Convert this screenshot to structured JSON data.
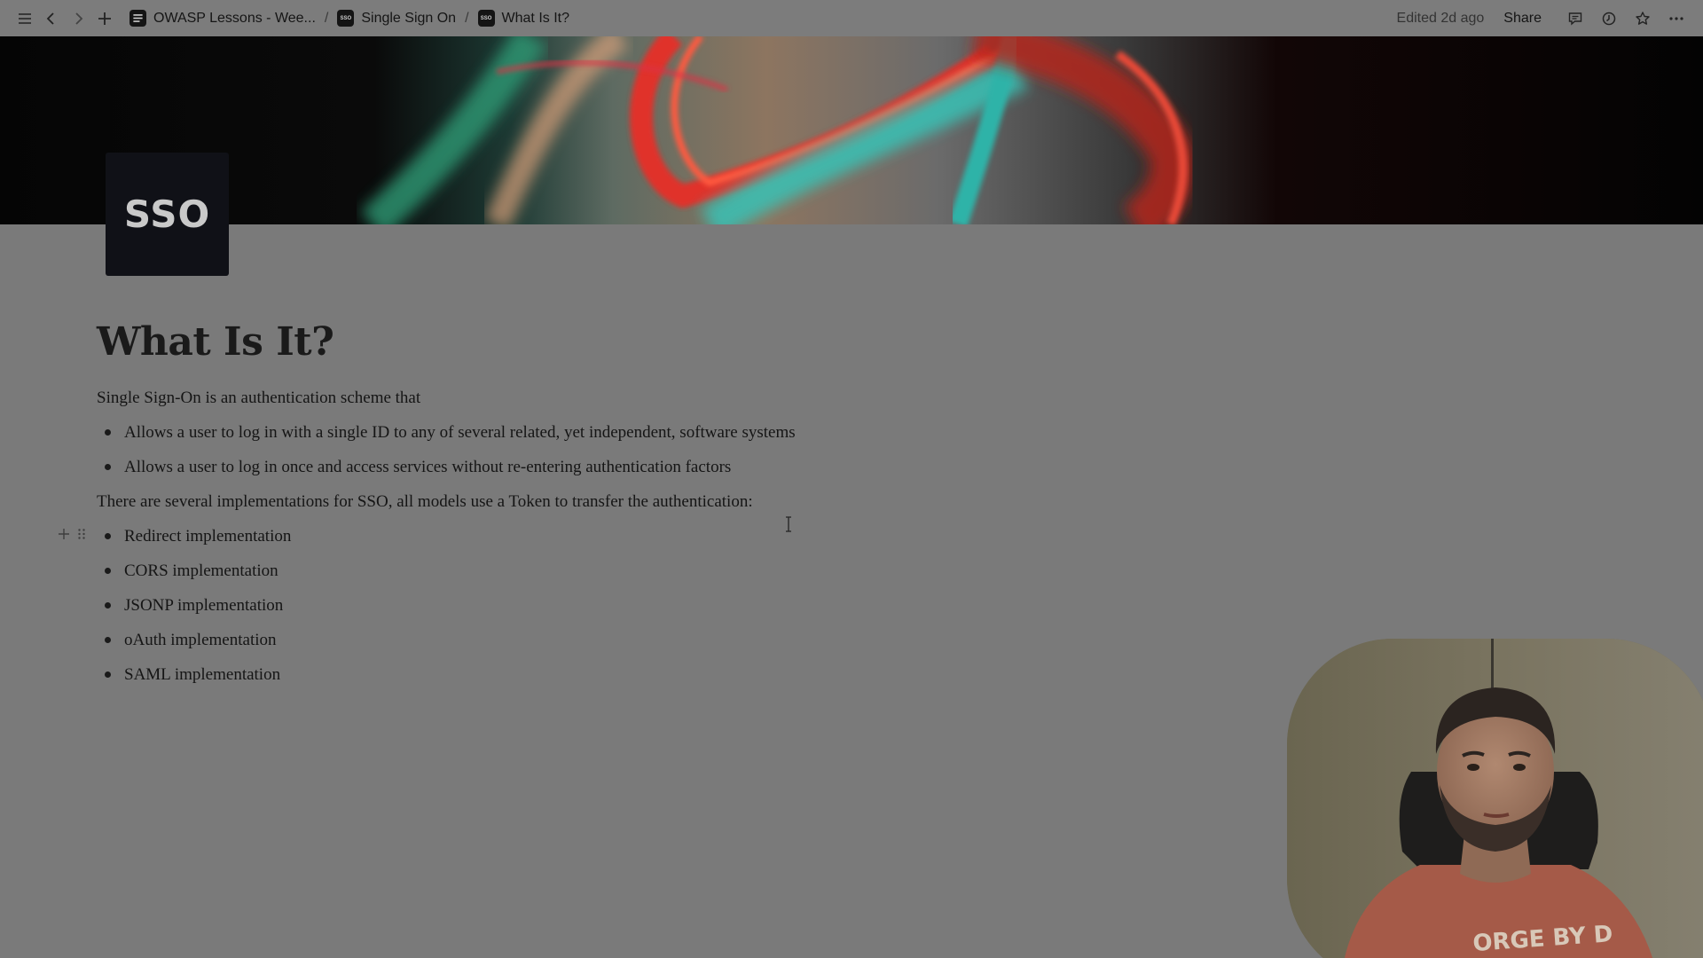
{
  "topbar": {
    "breadcrumbs": [
      {
        "label": "OWASP Lessons - Wee...",
        "icon": "notion-page-icon"
      },
      {
        "label": "Single Sign On",
        "icon": "sso-page-icon"
      },
      {
        "label": "What Is It?",
        "icon": "sso-page-icon"
      }
    ],
    "separator": "/",
    "edited": "Edited 2d ago",
    "share_label": "Share"
  },
  "page": {
    "icon_text": "SSO",
    "title": "What Is It?",
    "intro": "Single Sign-On is an authentication scheme that",
    "intro_bullets": [
      "Allows a user to log in with a single ID to any of several related, yet independent, software systems",
      "Allows a user to log in once and access services without re-entering authentication factors"
    ],
    "impl_intro": "There are several implementations for SSO, all models use a Token to transfer the authentication:",
    "impl_bullets": [
      "Redirect implementation",
      "CORS implementation",
      "JSONP implementation",
      "oAuth implementation",
      "SAML implementation"
    ]
  },
  "webcam": {
    "shirt_text": "ORGE BY D"
  },
  "colors": {
    "background": "#7a7a7a",
    "cover_red": "#e0322a",
    "cover_teal": "#30b8b0"
  }
}
